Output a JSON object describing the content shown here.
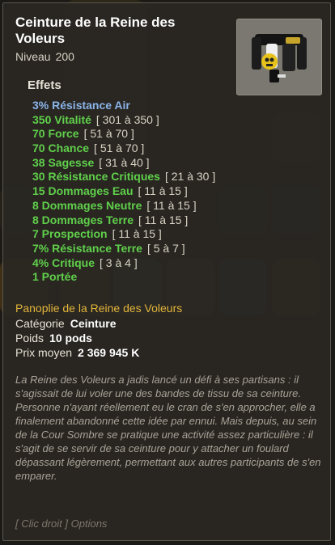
{
  "item": {
    "name": "Ceinture de la Reine des Voleurs",
    "level_label": "Niveau",
    "level_value": "200"
  },
  "effects": {
    "title": "Effets",
    "lines": [
      {
        "main": "3% Résistance Air",
        "range": "",
        "color": "#8ab4e8"
      },
      {
        "main": "350 Vitalité",
        "range": "[ 301 à 350 ]",
        "color": "#5fd04a"
      },
      {
        "main": "70 Force",
        "range": "[ 51 à 70 ]",
        "color": "#5fd04a"
      },
      {
        "main": "70 Chance",
        "range": "[ 51 à 70 ]",
        "color": "#5fd04a"
      },
      {
        "main": "38 Sagesse",
        "range": "[ 31 à 40 ]",
        "color": "#5fd04a"
      },
      {
        "main": "30 Résistance Critiques",
        "range": "[ 21 à 30 ]",
        "color": "#5fd04a"
      },
      {
        "main": "15 Dommages Eau",
        "range": "[ 11 à 15 ]",
        "color": "#5fd04a"
      },
      {
        "main": "8 Dommages Neutre",
        "range": "[ 11 à 15 ]",
        "color": "#5fd04a"
      },
      {
        "main": "8 Dommages Terre",
        "range": "[ 11 à 15 ]",
        "color": "#5fd04a"
      },
      {
        "main": "7 Prospection",
        "range": "[ 11 à 15 ]",
        "color": "#5fd04a"
      },
      {
        "main": "7% Résistance Terre",
        "range": "[ 5 à 7 ]",
        "color": "#5fd04a"
      },
      {
        "main": "4% Critique",
        "range": "[ 3 à 4 ]",
        "color": "#5fd04a"
      },
      {
        "main": "1 Portée",
        "range": "",
        "color": "#5fd04a"
      }
    ]
  },
  "details": {
    "set_name": "Panoplie de la Reine des Voleurs",
    "category_label": "Catégorie",
    "category_value": "Ceinture",
    "weight_label": "Poids",
    "weight_value": "10 pods",
    "price_label": "Prix moyen",
    "price_value": "2 369 945 K"
  },
  "description": "La Reine des Voleurs a jadis lancé un défi à ses partisans : il s'agissait de lui voler une des bandes de tissu de sa ceinture. Personne n'ayant réellement eu le cran de s'en approcher, elle a finalement abandonné cette idée par ennui. Mais depuis, au sein de la Cour Sombre se pratique une activité assez particulière : il s'agit de se servir de sa ceinture pour y attacher un foulard dépassant légèrement, permettant aux autres participants de s'en emparer.",
  "hint": "[ Clic droit ] Options",
  "icons": {
    "item": "belt-item-icon"
  },
  "colors": {
    "set": "#e2b53a",
    "positive_effect": "#5fd04a",
    "neutral_effect": "#8ab4e8"
  }
}
